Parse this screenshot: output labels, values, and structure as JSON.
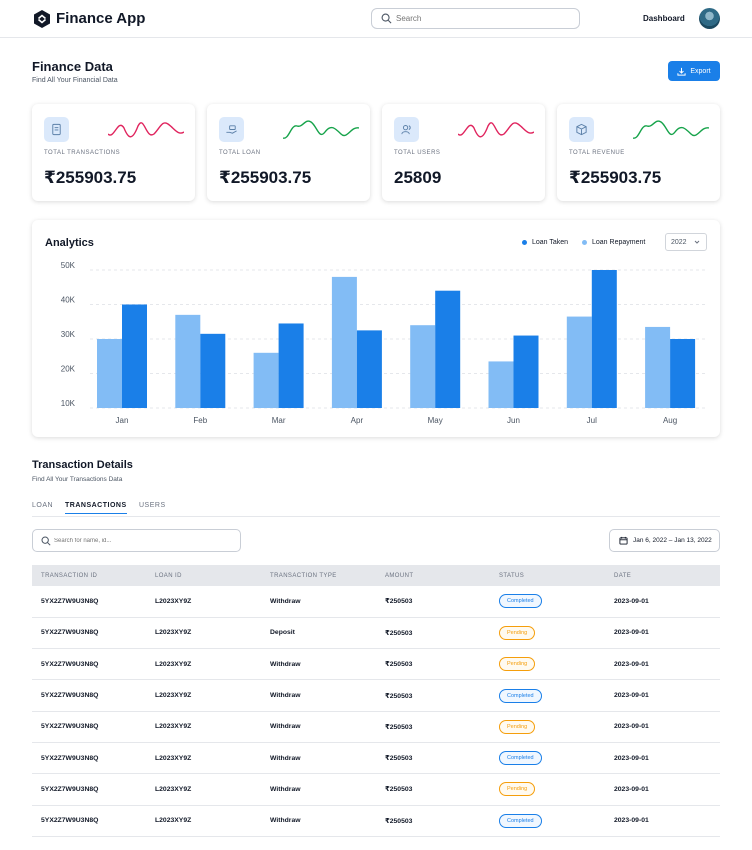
{
  "app": {
    "title": "Finance App"
  },
  "header": {
    "search_placeholder": "Search",
    "nav_label": "Dashboard"
  },
  "page": {
    "title": "Finance Data",
    "subtitle": "Find All Your Financial Data",
    "export_label": "Export"
  },
  "cards": [
    {
      "label": "TOTAL TRANSACTIONS",
      "value": "₹255903.75",
      "icon": "receipt-icon",
      "trend_color": "#e0245e"
    },
    {
      "label": "TOTAL LOAN",
      "value": "₹255903.75",
      "icon": "hand-money-icon",
      "trend_color": "#16a34a"
    },
    {
      "label": "TOTAL USERS",
      "value": "25809",
      "icon": "users-icon",
      "trend_color": "#e0245e"
    },
    {
      "label": "TOTAL REVENUE",
      "value": "₹255903.75",
      "icon": "box-icon",
      "trend_color": "#16a34a"
    }
  ],
  "analytics": {
    "title": "Analytics",
    "year": "2022",
    "colors": {
      "loan_taken": "#1a7fe8",
      "loan_repayment": "#82bcf5"
    }
  },
  "chart_data": {
    "type": "bar",
    "categories": [
      "Jan",
      "Feb",
      "Mar",
      "Apr",
      "May",
      "Jun",
      "Jul",
      "Aug"
    ],
    "series": [
      {
        "name": "Loan Repayment",
        "values": [
          30000,
          37000,
          26000,
          48000,
          34000,
          23500,
          36500,
          33500
        ]
      },
      {
        "name": "Loan Taken",
        "values": [
          40000,
          31500,
          34500,
          32500,
          44000,
          31000,
          50000,
          30000
        ]
      }
    ],
    "yticks": [
      "10K",
      "20K",
      "30K",
      "40K",
      "50K"
    ],
    "ylim": [
      10000,
      50000
    ],
    "grid": true,
    "legend": "top-right"
  },
  "transactions": {
    "title": "Transaction Details",
    "subtitle": "Find All Your Transactions Data",
    "tabs": [
      "LOAN",
      "TRANSACTIONS",
      "USERS"
    ],
    "search_placeholder": "Search for name, id...",
    "date_range": "Jan 6, 2022 – Jan 13, 2022",
    "columns": [
      "TRANSACTION ID",
      "LOAN ID",
      "TRANSACTION TYPE",
      "AMOUNT",
      "STATUS",
      "DATE"
    ],
    "rows": [
      {
        "id": "5YX2Z7W9U3N8Q",
        "loan": "L2023XY9Z",
        "type": "Withdraw",
        "amount": "₹250503",
        "status": "Completed",
        "date": "2023-09-01"
      },
      {
        "id": "5YX2Z7W9U3N8Q",
        "loan": "L2023XY9Z",
        "type": "Deposit",
        "amount": "₹250503",
        "status": "Pending",
        "date": "2023-09-01"
      },
      {
        "id": "5YX2Z7W9U3N8Q",
        "loan": "L2023XY9Z",
        "type": "Withdraw",
        "amount": "₹250503",
        "status": "Pending",
        "date": "2023-09-01"
      },
      {
        "id": "5YX2Z7W9U3N8Q",
        "loan": "L2023XY9Z",
        "type": "Withdraw",
        "amount": "₹250503",
        "status": "Completed",
        "date": "2023-09-01"
      },
      {
        "id": "5YX2Z7W9U3N8Q",
        "loan": "L2023XY9Z",
        "type": "Withdraw",
        "amount": "₹250503",
        "status": "Pending",
        "date": "2023-09-01"
      },
      {
        "id": "5YX2Z7W9U3N8Q",
        "loan": "L2023XY9Z",
        "type": "Withdraw",
        "amount": "₹250503",
        "status": "Completed",
        "date": "2023-09-01"
      },
      {
        "id": "5YX2Z7W9U3N8Q",
        "loan": "L2023XY9Z",
        "type": "Withdraw",
        "amount": "₹250503",
        "status": "Pending",
        "date": "2023-09-01"
      },
      {
        "id": "5YX2Z7W9U3N8Q",
        "loan": "L2023XY9Z",
        "type": "Withdraw",
        "amount": "₹250503",
        "status": "Completed",
        "date": "2023-09-01"
      }
    ]
  }
}
